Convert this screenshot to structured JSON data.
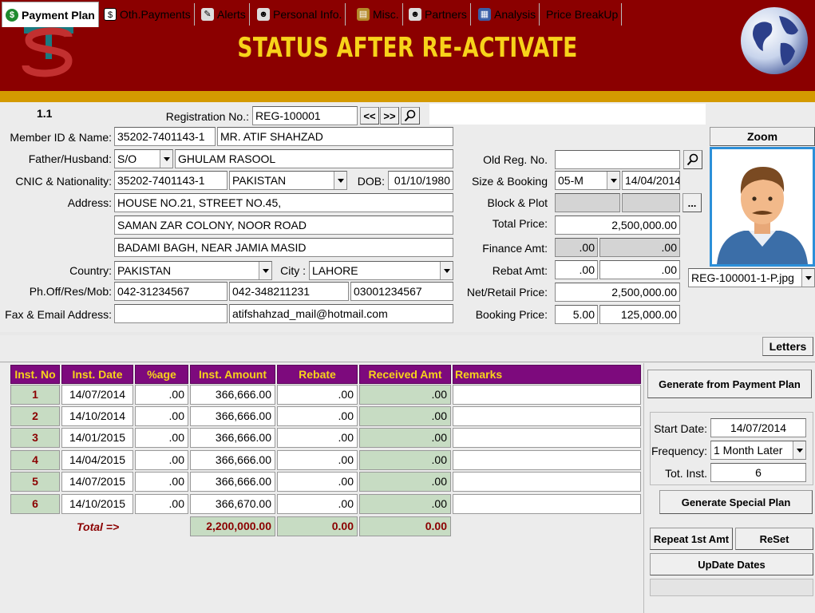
{
  "header": {
    "title": "STATUS AFTER RE-ACTIVATE"
  },
  "version": "1.1",
  "form": {
    "reg_label": "Registration No.:",
    "reg_value": "REG-100001",
    "prev_label": "<<",
    "next_label": ">>",
    "member_label": "Member ID & Name:",
    "member_id": "35202-7401143-1",
    "member_name": "MR. ATIF SHAHZAD",
    "father_label": "Father/Husband:",
    "relation": "S/O",
    "father_name": "GHULAM RASOOL",
    "cnic_label": "CNIC & Nationality:",
    "cnic": "35202-7401143-1",
    "nationality": "PAKISTAN",
    "dob_label": "DOB:",
    "dob": "01/10/1980",
    "address_label": "Address:",
    "address1": "HOUSE NO.21, STREET NO.45,",
    "address2": "SAMAN ZAR COLONY, NOOR ROAD",
    "address3": "BADAMI BAGH, NEAR JAMIA MASID",
    "country_label": "Country:",
    "country": "PAKISTAN",
    "city_label": "City :",
    "city": "LAHORE",
    "phone_label": "Ph.Off/Res/Mob:",
    "phone_off": "042-31234567",
    "phone_res": "042-348211231",
    "phone_mob": "03001234567",
    "fax_label": "Fax & Email Address:",
    "fax": "",
    "email": "atifshahzad_mail@hotmail.com",
    "oldreg_label": "Old Reg. No.",
    "oldreg": "",
    "size_label": "Size & Booking",
    "size": "05-M",
    "booking_date": "14/04/2014",
    "block_label": "Block & Plot",
    "block": "",
    "plot": "",
    "plot_btn": "...",
    "total_label": "Total Price:",
    "total": "2,500,000.00",
    "finance_label": "Finance Amt:",
    "finance_pct": ".00",
    "finance_amt": ".00",
    "rebat_label": "Rebat Amt:",
    "rebat_pct": ".00",
    "rebat_amt": ".00",
    "net_label": "Net/Retail Price:",
    "net": "2,500,000.00",
    "bookingprice_label": "Booking Price:",
    "booking_pct": "5.00",
    "booking_amt": "125,000.00",
    "zoom_label": "Zoom",
    "photo_file": "REG-100001-1-P.jpg"
  },
  "tabs": [
    {
      "label": "Payment Plan"
    },
    {
      "label": "Oth.Payments"
    },
    {
      "label": "Alerts"
    },
    {
      "label": "Personal Info."
    },
    {
      "label": "Misc."
    },
    {
      "label": "Partners"
    },
    {
      "label": "Analysis"
    },
    {
      "label": "Price BreakUp"
    }
  ],
  "letters_label": "Letters",
  "table": {
    "headers": [
      "Inst. No",
      "Inst. Date",
      "%age",
      "Inst. Amount",
      "Rebate",
      "Received Amt",
      "Remarks"
    ],
    "rows": [
      [
        "1",
        "14/07/2014",
        ".00",
        "366,666.00",
        ".00",
        ".00",
        ""
      ],
      [
        "2",
        "14/10/2014",
        ".00",
        "366,666.00",
        ".00",
        ".00",
        ""
      ],
      [
        "3",
        "14/01/2015",
        ".00",
        "366,666.00",
        ".00",
        ".00",
        ""
      ],
      [
        "4",
        "14/04/2015",
        ".00",
        "366,666.00",
        ".00",
        ".00",
        ""
      ],
      [
        "5",
        "14/07/2015",
        ".00",
        "366,666.00",
        ".00",
        ".00",
        ""
      ],
      [
        "6",
        "14/10/2015",
        ".00",
        "366,670.00",
        ".00",
        ".00",
        ""
      ]
    ],
    "total_label": "Total =>",
    "total_amount": "2,200,000.00",
    "total_rebate": "0.00",
    "total_received": "0.00"
  },
  "plan": {
    "generate_label": "Generate from Payment Plan",
    "start_label": "Start Date:",
    "start": "14/07/2014",
    "freq_label": "Frequency:",
    "freq": "1 Month Later",
    "totinst_label": "Tot. Inst.",
    "totinst": "6",
    "special_label": "Generate Special Plan",
    "repeat_label": "Repeat 1st Amt",
    "reset_label": "ReSet",
    "update_label": "UpDate Dates"
  },
  "colors": {
    "header": "#8b0000",
    "title": "#f7d31a",
    "table_header": "#7d0a7d",
    "accent": "#2c8fd8"
  }
}
